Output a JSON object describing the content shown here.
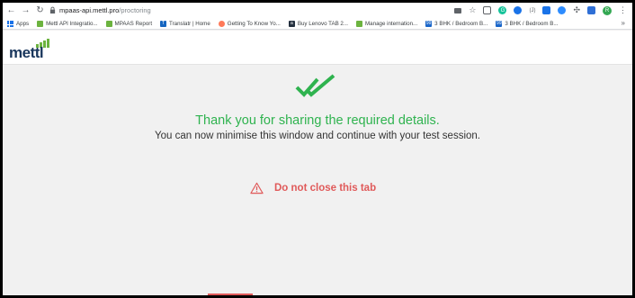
{
  "browser": {
    "url_host": "mpaas-api.mettl.pro",
    "url_path": "/proctoring",
    "profile_initial": "R"
  },
  "bookmarks": [
    {
      "label": "Apps",
      "icon": "apps-grid-icon"
    },
    {
      "label": "Mettl API Integratio...",
      "icon": "mettl-icon"
    },
    {
      "label": "MPAAS Report",
      "icon": "mettl-icon"
    },
    {
      "label": "Translatr | Home",
      "icon": "translatr-icon"
    },
    {
      "label": "Getting To Know Yo...",
      "icon": "hubspot-icon"
    },
    {
      "label": "Buy Lenovo TAB 2...",
      "icon": "amazon-icon"
    },
    {
      "label": "Manage internation...",
      "icon": "mettl-icon"
    },
    {
      "label": "3 BHK / Bedroom B...",
      "icon": "99acres-icon"
    },
    {
      "label": "3 BHK / Bedroom B...",
      "icon": "99acres-icon"
    }
  ],
  "site": {
    "logo_text": "mettl"
  },
  "main": {
    "thanks": "Thank you for sharing the required details.",
    "sub": "You can now minimise this window and continue with your test session.",
    "warning": "Do not close this tab"
  },
  "colors": {
    "success": "#2fb34f",
    "warning": "#e05a5a",
    "logo_navy": "#19365c",
    "logo_green": "#6cb33f"
  }
}
